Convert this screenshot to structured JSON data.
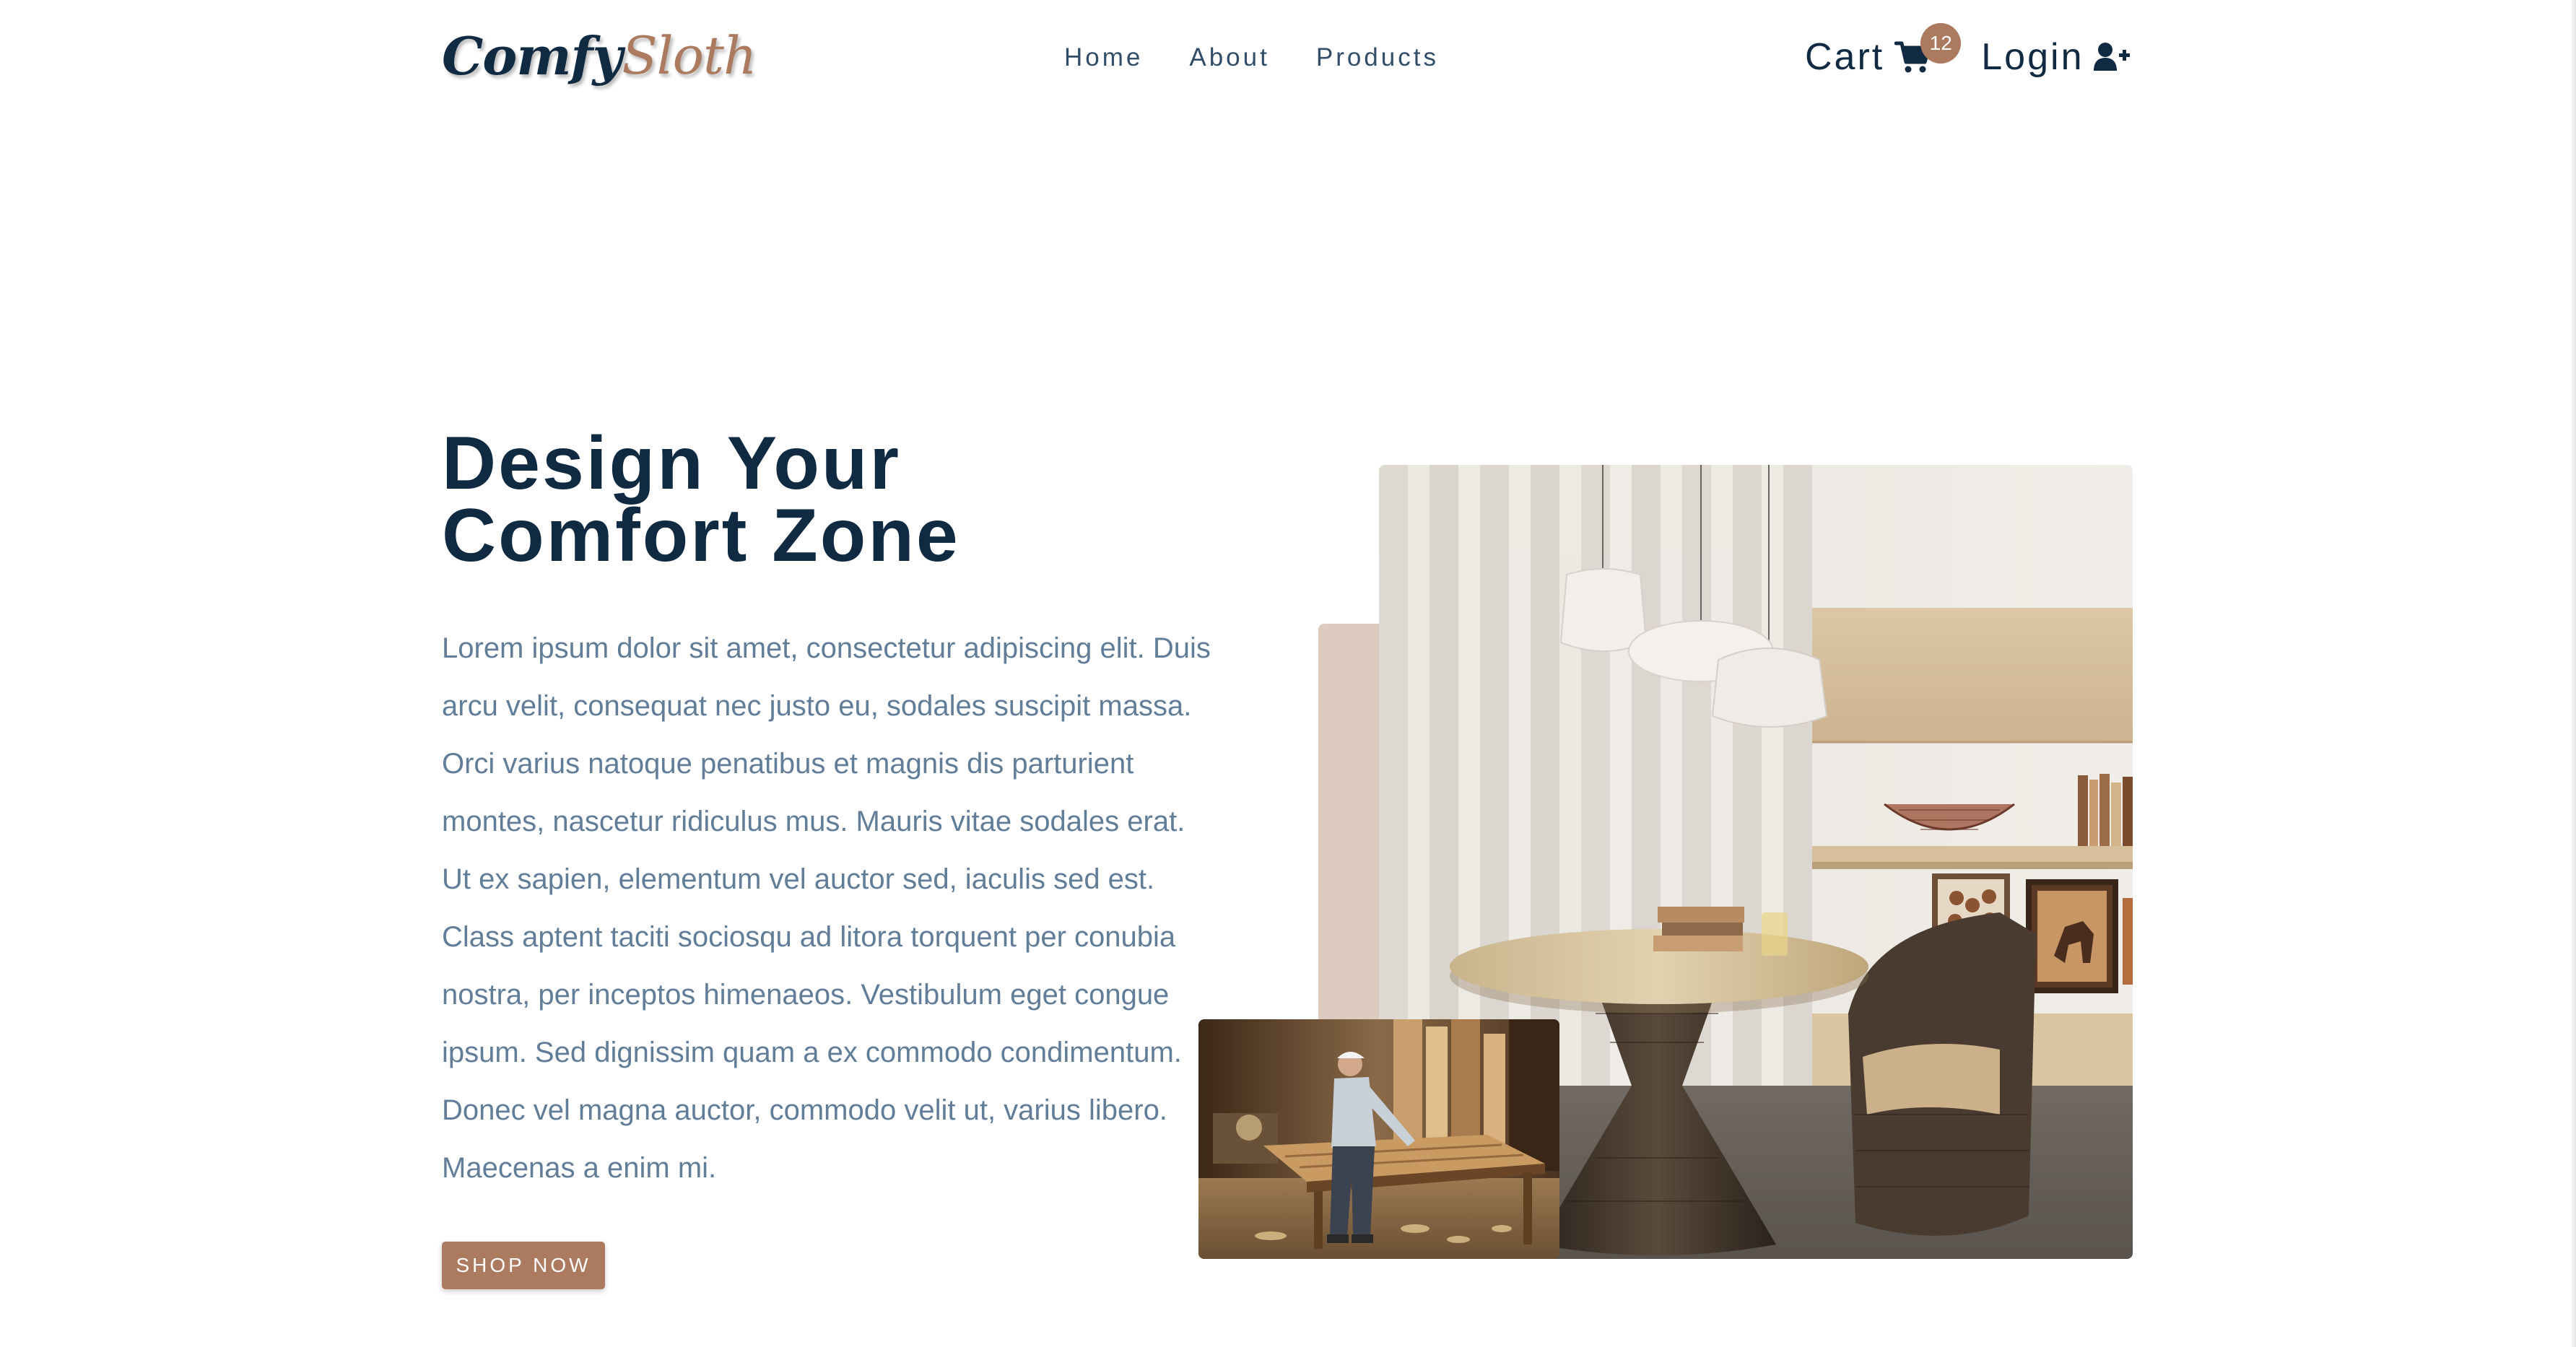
{
  "brand": {
    "part_a": "Comfy",
    "part_b": "Sloth"
  },
  "nav": {
    "links": [
      {
        "label": "Home"
      },
      {
        "label": "About"
      },
      {
        "label": "Products"
      }
    ],
    "cart_label": "Cart",
    "cart_count": "12",
    "login_label": "Login"
  },
  "hero": {
    "title_line1": "Design Your",
    "title_line2": "Comfort Zone",
    "text": "Lorem ipsum dolor sit amet, consectetur adipiscing elit. Duis arcu velit, consequat nec justo eu, sodales suscipit massa. Orci varius natoque penatibus et magnis dis parturient montes, nascetur ridiculus mus. Mauris vitae sodales erat. Ut ex sapien, elementum vel auctor sed, iaculis sed est. Class aptent taciti sociosqu ad litora torquent per conubia nostra, per inceptos himenaeos. Vestibulum eget congue ipsum. Sed dignissim quam a ex commodo condimentum. Donec vel magna auctor, commodo velit ut, varius libero. Maecenas a enim mi.",
    "cta_label": "SHOP NOW"
  },
  "colors": {
    "primary": "#ab7a5f",
    "heading": "#102a42",
    "body_text": "#617d98",
    "accent_block": "#decbc0"
  },
  "icons": {
    "cart": "shopping-cart-icon",
    "login": "user-plus-icon"
  }
}
